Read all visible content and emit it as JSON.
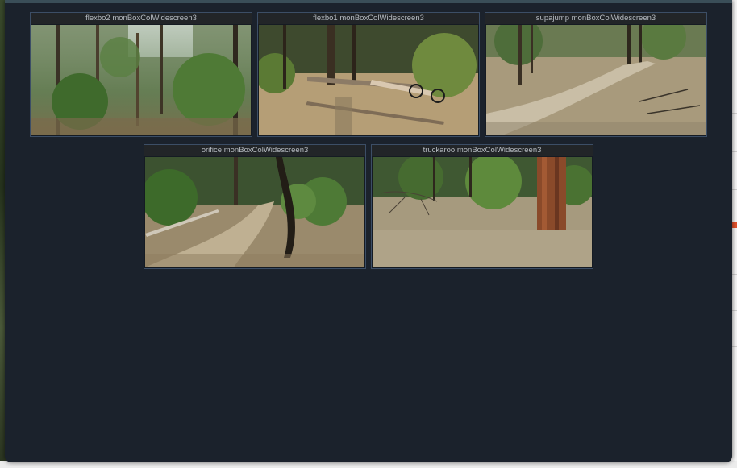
{
  "window": {
    "background": "#1b222c",
    "tile_border": "#3c4e66"
  },
  "tiles": [
    {
      "title": "flexbo2 monBoxColWidescreen3",
      "scene": "dense-pine-forest-photo"
    },
    {
      "title": "flexbo1 monBoxColWidescreen3",
      "scene": "fallen-log-bike-photo"
    },
    {
      "title": "supajump monBoxColWidescreen3",
      "scene": "forest-trail-photo"
    },
    {
      "title": "orifice monBoxColWidescreen3",
      "scene": "curving-trail-photo"
    },
    {
      "title": "truckaroo monBoxColWidescreen3",
      "scene": "ponderosa-trunk-photo"
    }
  ]
}
